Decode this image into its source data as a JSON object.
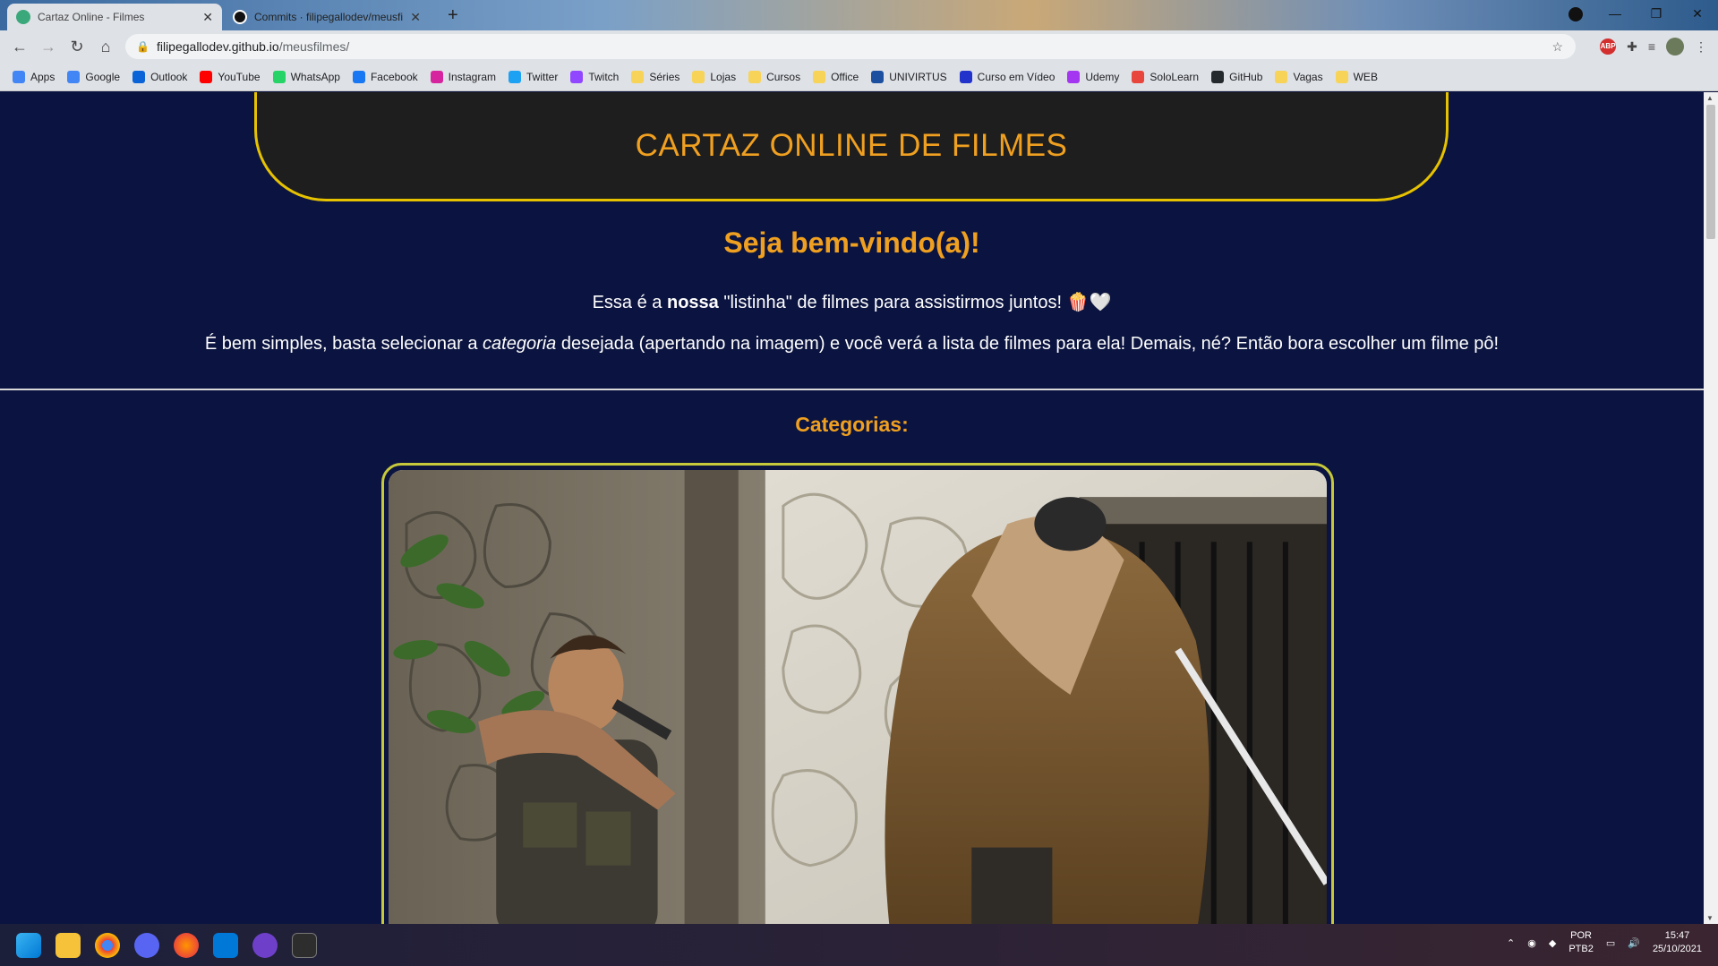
{
  "browser": {
    "tabs": [
      {
        "title": "Cartaz Online - Filmes",
        "active": true
      },
      {
        "title": "Commits · filipegallodev/meusfilmes",
        "active": false
      }
    ],
    "url_host": "filipegallodev.github.io",
    "url_path": "/meusfilmes/",
    "bookmarks": [
      {
        "label": "Apps",
        "icon": "apps-grid-icon",
        "color": "#4285f4"
      },
      {
        "label": "Google",
        "icon": "google-icon",
        "color": "#4285f4"
      },
      {
        "label": "Outlook",
        "icon": "outlook-icon",
        "color": "#0a64d8"
      },
      {
        "label": "YouTube",
        "icon": "youtube-icon",
        "color": "#ff0000"
      },
      {
        "label": "WhatsApp",
        "icon": "whatsapp-icon",
        "color": "#25d366"
      },
      {
        "label": "Facebook",
        "icon": "facebook-icon",
        "color": "#1877f2"
      },
      {
        "label": "Instagram",
        "icon": "instagram-icon",
        "color": "#d6249f"
      },
      {
        "label": "Twitter",
        "icon": "twitter-icon",
        "color": "#1da1f2"
      },
      {
        "label": "Twitch",
        "icon": "twitch-icon",
        "color": "#9146ff"
      },
      {
        "label": "Séries",
        "icon": "folder-icon",
        "color": "#f7d358"
      },
      {
        "label": "Lojas",
        "icon": "folder-icon",
        "color": "#f7d358"
      },
      {
        "label": "Cursos",
        "icon": "folder-icon",
        "color": "#f7d358"
      },
      {
        "label": "Office",
        "icon": "folder-icon",
        "color": "#f7d358"
      },
      {
        "label": "UNIVIRTUS",
        "icon": "univirtus-icon",
        "color": "#1d4fa0"
      },
      {
        "label": "Curso em Vídeo",
        "icon": "curso-em-video-icon",
        "color": "#2233cc"
      },
      {
        "label": "Udemy",
        "icon": "udemy-icon",
        "color": "#a435f0"
      },
      {
        "label": "SoloLearn",
        "icon": "sololearn-icon",
        "color": "#e8453c"
      },
      {
        "label": "GitHub",
        "icon": "github-icon",
        "color": "#24292e"
      },
      {
        "label": "Vagas",
        "icon": "folder-icon",
        "color": "#f7d358"
      },
      {
        "label": "WEB",
        "icon": "folder-icon",
        "color": "#f7d358"
      }
    ]
  },
  "page": {
    "site_title": "CARTAZ ONLINE DE FILMES",
    "welcome": "Seja bem-vindo(a)!",
    "intro": {
      "before": "Essa é a ",
      "bold": "nossa",
      "after": " \"listinha\" de filmes para assistirmos juntos! 🍿🤍"
    },
    "instructions": {
      "before": "É bem simples, basta selecionar a ",
      "italic": "categoria",
      "after": " desejada (apertando na imagem) e você verá a lista de filmes para ela! Demais, né? Então bora escolher um filme pô!"
    },
    "categories_heading": "Categorias:",
    "category_image_alt": "war-soldiers-category-image"
  },
  "taskbar": {
    "apps": [
      "windows-start-icon",
      "file-explorer-icon",
      "chrome-icon",
      "discord-icon",
      "firefox-icon",
      "vscode-icon",
      "github-desktop-icon",
      "terminal-icon"
    ],
    "lang_line1": "POR",
    "lang_line2": "PTB2",
    "time": "15:47",
    "date": "25/10/2021"
  },
  "colors": {
    "accent_orange": "#f0a020",
    "header_border_yellow": "#e6c200",
    "page_background": "#0b1440",
    "card_border": "#c7c93a"
  }
}
